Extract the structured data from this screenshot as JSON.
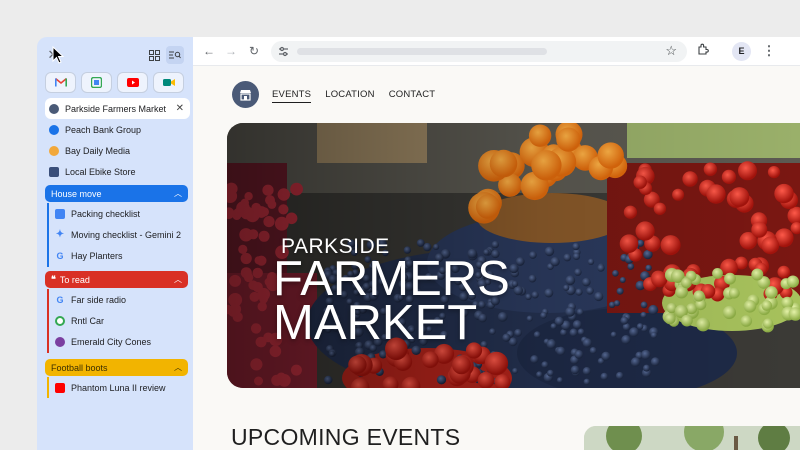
{
  "sidebar": {
    "close_icon": "close-icon",
    "tools": [
      "tab-grid-icon",
      "tab-search-icon"
    ],
    "pinned": [
      {
        "name": "gmail",
        "color": "#ea4335"
      },
      {
        "name": "drive",
        "color": "#34a853"
      },
      {
        "name": "youtube",
        "color": "#ff0000"
      },
      {
        "name": "meet",
        "color": "#00897b"
      }
    ],
    "tabs": [
      {
        "label": "Parkside Farmers Market"
      },
      {
        "label": "Peach Bank Group"
      },
      {
        "label": "Bay Daily Media"
      },
      {
        "label": "Local Ebike Store"
      }
    ],
    "groups": [
      {
        "label": "House move",
        "color": "#1a73e8",
        "tabs": [
          {
            "label": "Packing checklist"
          },
          {
            "label": "Moving checklist - Gemini 2"
          },
          {
            "label": "Hay Planters"
          }
        ]
      },
      {
        "label": "To read",
        "color": "#d93025",
        "tabs": [
          {
            "label": "Far side radio"
          },
          {
            "label": "Rntl Car"
          },
          {
            "label": "Emerald City Cones"
          }
        ]
      },
      {
        "label": "Football boots",
        "color": "#f2b400",
        "tabs": [
          {
            "label": "Phantom Luna II review"
          }
        ]
      }
    ]
  },
  "toolbar": {
    "profile_initial": "E"
  },
  "page": {
    "nav": [
      "EVENTS",
      "LOCATION",
      "CONTACT"
    ],
    "hero_sub": "PARKSIDE",
    "hero_title_1": "FARMERS",
    "hero_title_2": "MARKET",
    "upcoming": "UPCOMING EVENTS"
  }
}
